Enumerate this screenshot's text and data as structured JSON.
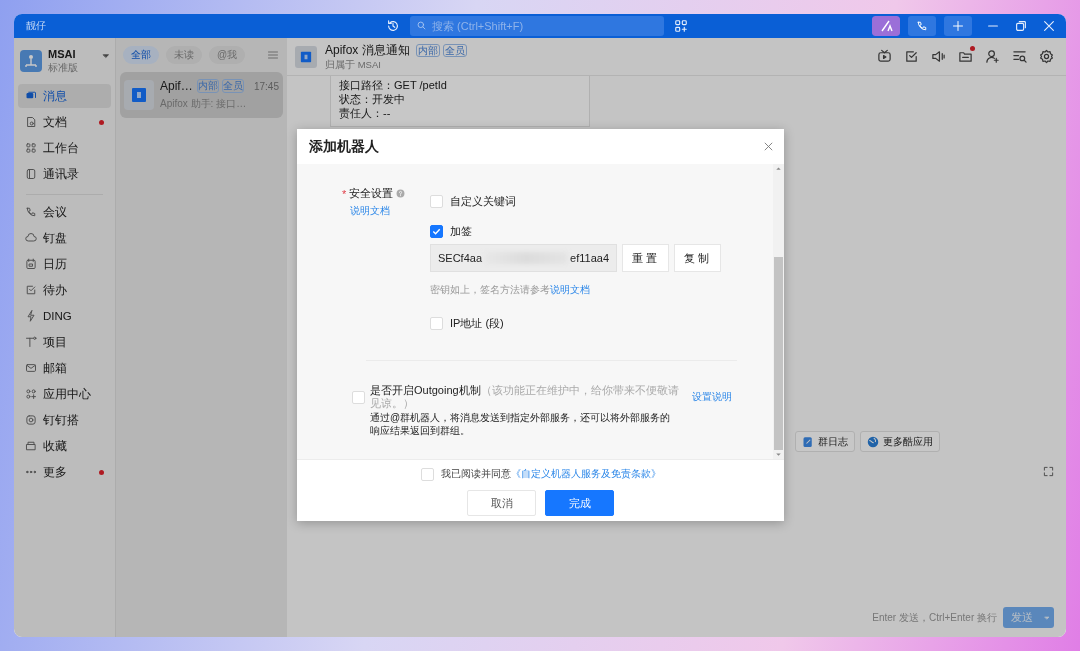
{
  "window": {
    "title": "靓仔"
  },
  "titlebar": {
    "search": {
      "placeholder": "搜索 (Ctrl+Shift+F)"
    }
  },
  "org": {
    "name": "MSAI",
    "plan": "标准版"
  },
  "nav": [
    {
      "label": "消息",
      "selected": true,
      "badge": false,
      "divider_before": false
    },
    {
      "label": "文档",
      "selected": false,
      "badge": true,
      "divider_before": false
    },
    {
      "label": "工作台",
      "selected": false,
      "badge": false,
      "divider_before": false
    },
    {
      "label": "通讯录",
      "selected": false,
      "badge": false,
      "divider_before": false
    },
    {
      "label": "会议",
      "selected": false,
      "badge": false,
      "divider_before": true
    },
    {
      "label": "钉盘",
      "selected": false,
      "badge": false,
      "divider_before": false
    },
    {
      "label": "日历",
      "selected": false,
      "badge": false,
      "divider_before": false
    },
    {
      "label": "待办",
      "selected": false,
      "badge": false,
      "divider_before": false
    },
    {
      "label": "DING",
      "selected": false,
      "badge": false,
      "divider_before": false
    },
    {
      "label": "项目",
      "selected": false,
      "badge": false,
      "divider_before": false
    },
    {
      "label": "邮箱",
      "selected": false,
      "badge": false,
      "divider_before": false
    },
    {
      "label": "应用中心",
      "selected": false,
      "badge": false,
      "divider_before": false
    },
    {
      "label": "钉钉搭",
      "selected": false,
      "badge": false,
      "divider_before": false
    },
    {
      "label": "收藏",
      "selected": false,
      "badge": false,
      "divider_before": false
    },
    {
      "label": "更多",
      "selected": false,
      "badge": true,
      "divider_before": false
    }
  ],
  "filters": [
    {
      "label": "全部",
      "selected": true
    },
    {
      "label": "未读",
      "selected": false
    },
    {
      "label": "@我",
      "selected": false
    }
  ],
  "conversations": [
    {
      "name": "Apif…",
      "tags": [
        "内部",
        "全员"
      ],
      "time": "17:45",
      "preview": "Apifox 助手: 接口…",
      "selected": true
    }
  ],
  "chat": {
    "name": "Apifox 消息通知",
    "tags": [
      "内部",
      "全员"
    ],
    "subtitle": "归属于 MSAI",
    "toolbar": [
      {
        "dot": false
      },
      {
        "dot": false
      },
      {
        "dot": false
      },
      {
        "dot": true
      },
      {
        "dot": false
      },
      {
        "dot": false
      },
      {
        "dot": false
      }
    ],
    "message_lines": [
      "接口路径：GET /petId",
      "状态：开发中",
      "责任人：--"
    ],
    "apps": [
      "群日志",
      "更多酷应用"
    ],
    "hint": "Enter 发送，Ctrl+Enter 换行",
    "send": "发送"
  },
  "dialog": {
    "title": "添加机器人",
    "security": {
      "required_mark": "*",
      "label": "安全设置",
      "doc_link": "说明文档",
      "options": [
        {
          "kind": "checkbox",
          "label": "自定义关键词",
          "checked": false
        },
        {
          "kind": "checkbox",
          "label": "加签",
          "checked": true
        },
        {
          "kind": "secret",
          "value_start": "SECf4aa",
          "value_end": "ef11aa4",
          "buttons": [
            "重置",
            "复制"
          ]
        },
        {
          "kind": "hint",
          "text": "密钥如上，签名方法请参考",
          "link": "说明文档"
        },
        {
          "kind": "checkbox",
          "label": "IP地址 (段)",
          "checked": false
        }
      ]
    },
    "outgoing": {
      "checked": false,
      "label": "是否开启Outgoing机制",
      "note": "（该功能正在维护中，给你带来不便敬请见谅。）",
      "link": "设置说明",
      "description": "通过@群机器人，将消息发送到指定外部服务，还可以将外部服务的响应结果返回到群组。"
    },
    "agreement": {
      "checked": false,
      "text": "我已阅读并同意",
      "link": "《自定义机器人服务及免责条款》"
    },
    "buttons": [
      {
        "label": "取消",
        "kind": "secondary"
      },
      {
        "label": "完成",
        "kind": "primary"
      }
    ]
  }
}
